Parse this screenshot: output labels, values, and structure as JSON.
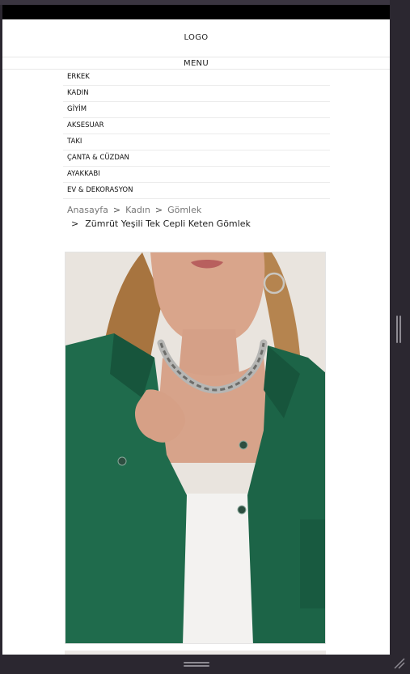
{
  "header": {
    "logo": "LOGO",
    "menu": "MENU"
  },
  "nav": {
    "items": [
      "ERKEK",
      "KADIN",
      "GİYİM",
      "AKSESUAR",
      "TAKI",
      "ÇANTA & CÜZDAN",
      "AYAKKABI",
      "EV & DEKORASYON"
    ]
  },
  "breadcrumb": {
    "items": [
      "Anasayfa",
      "Kadın",
      "Gömlek"
    ],
    "separator": ">",
    "current": "Zümrüt Yeşili Tek Cepli Keten Gömlek"
  },
  "product": {
    "image_icon": "product-photo",
    "shirt_color": "#1f6b4c"
  }
}
